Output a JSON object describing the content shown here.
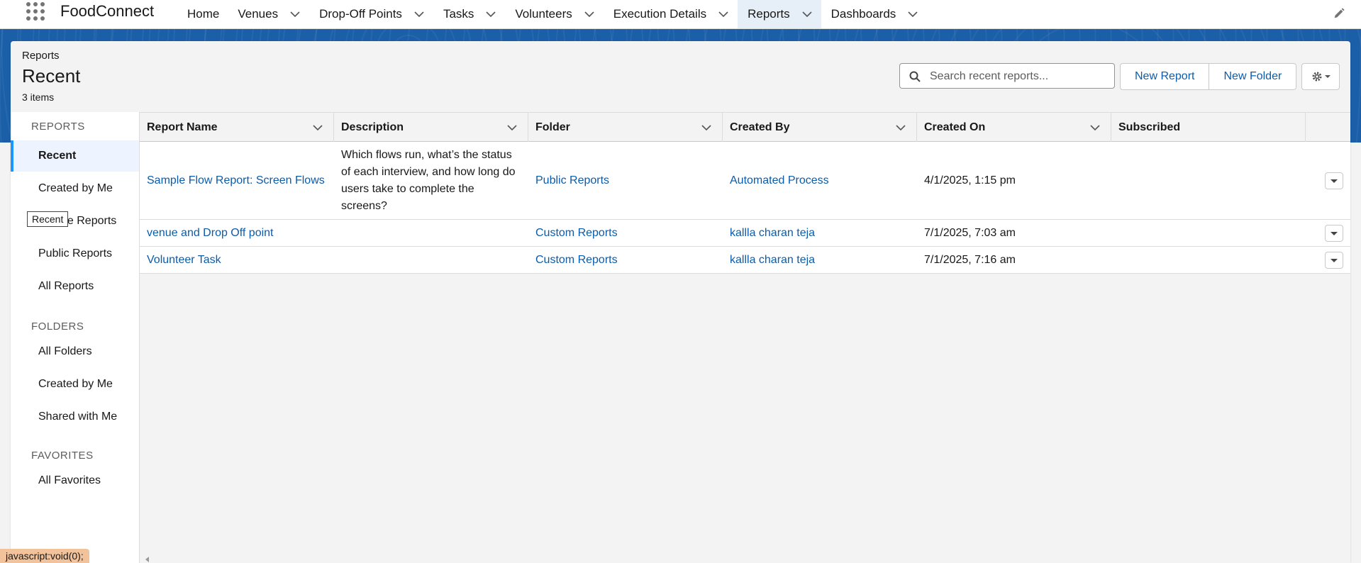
{
  "app": {
    "name": "FoodConnect"
  },
  "nav": {
    "items": [
      {
        "label": "Home",
        "has_menu": false
      },
      {
        "label": "Venues",
        "has_menu": true
      },
      {
        "label": "Drop-Off Points",
        "has_menu": true
      },
      {
        "label": "Tasks",
        "has_menu": true
      },
      {
        "label": "Volunteers",
        "has_menu": true
      },
      {
        "label": "Execution Details",
        "has_menu": true
      },
      {
        "label": "Reports",
        "has_menu": true,
        "active": true
      },
      {
        "label": "Dashboards",
        "has_menu": true
      }
    ]
  },
  "header": {
    "breadcrumb": "Reports",
    "title": "Recent",
    "count": "3 items"
  },
  "search": {
    "placeholder": "Search recent reports...",
    "value": ""
  },
  "buttons": {
    "new_report": "New Report",
    "new_folder": "New Folder"
  },
  "sidebar": {
    "sections": [
      {
        "label": "REPORTS",
        "items": [
          "Recent",
          "Created by Me",
          "Private Reports",
          "Public Reports",
          "All Reports"
        ]
      },
      {
        "label": "FOLDERS",
        "items": [
          "All Folders",
          "Created by Me",
          "Shared with Me"
        ]
      },
      {
        "label": "FAVORITES",
        "items": [
          "All Favorites"
        ]
      }
    ],
    "active_item": "Recent",
    "tooltip": "Recent"
  },
  "table": {
    "columns": [
      "Report Name",
      "Description",
      "Folder",
      "Created By",
      "Created On",
      "Subscribed"
    ],
    "rows": [
      {
        "report_name": "Sample Flow Report: Screen Flows",
        "description": "Which flows run, what’s the status of each interview, and how long do users take to complete the screens?",
        "folder": "Public Reports",
        "created_by": "Automated Process",
        "created_on": "4/1/2025, 1:15 pm",
        "subscribed": ""
      },
      {
        "report_name": "venue and Drop Off point",
        "description": "",
        "folder": "Custom Reports",
        "created_by": "kallla charan teja",
        "created_on": "7/1/2025, 7:03 am",
        "subscribed": ""
      },
      {
        "report_name": "Volunteer Task",
        "description": "",
        "folder": "Custom Reports",
        "created_by": "kallla charan teja",
        "created_on": "7/1/2025, 7:16 am",
        "subscribed": ""
      }
    ]
  },
  "status_bar": "javascript:void(0);",
  "colors": {
    "brand": "#1b5fa8",
    "link": "#0b5cab",
    "active_accent": "#1b96ff",
    "status_bar": "#f2c39b"
  }
}
